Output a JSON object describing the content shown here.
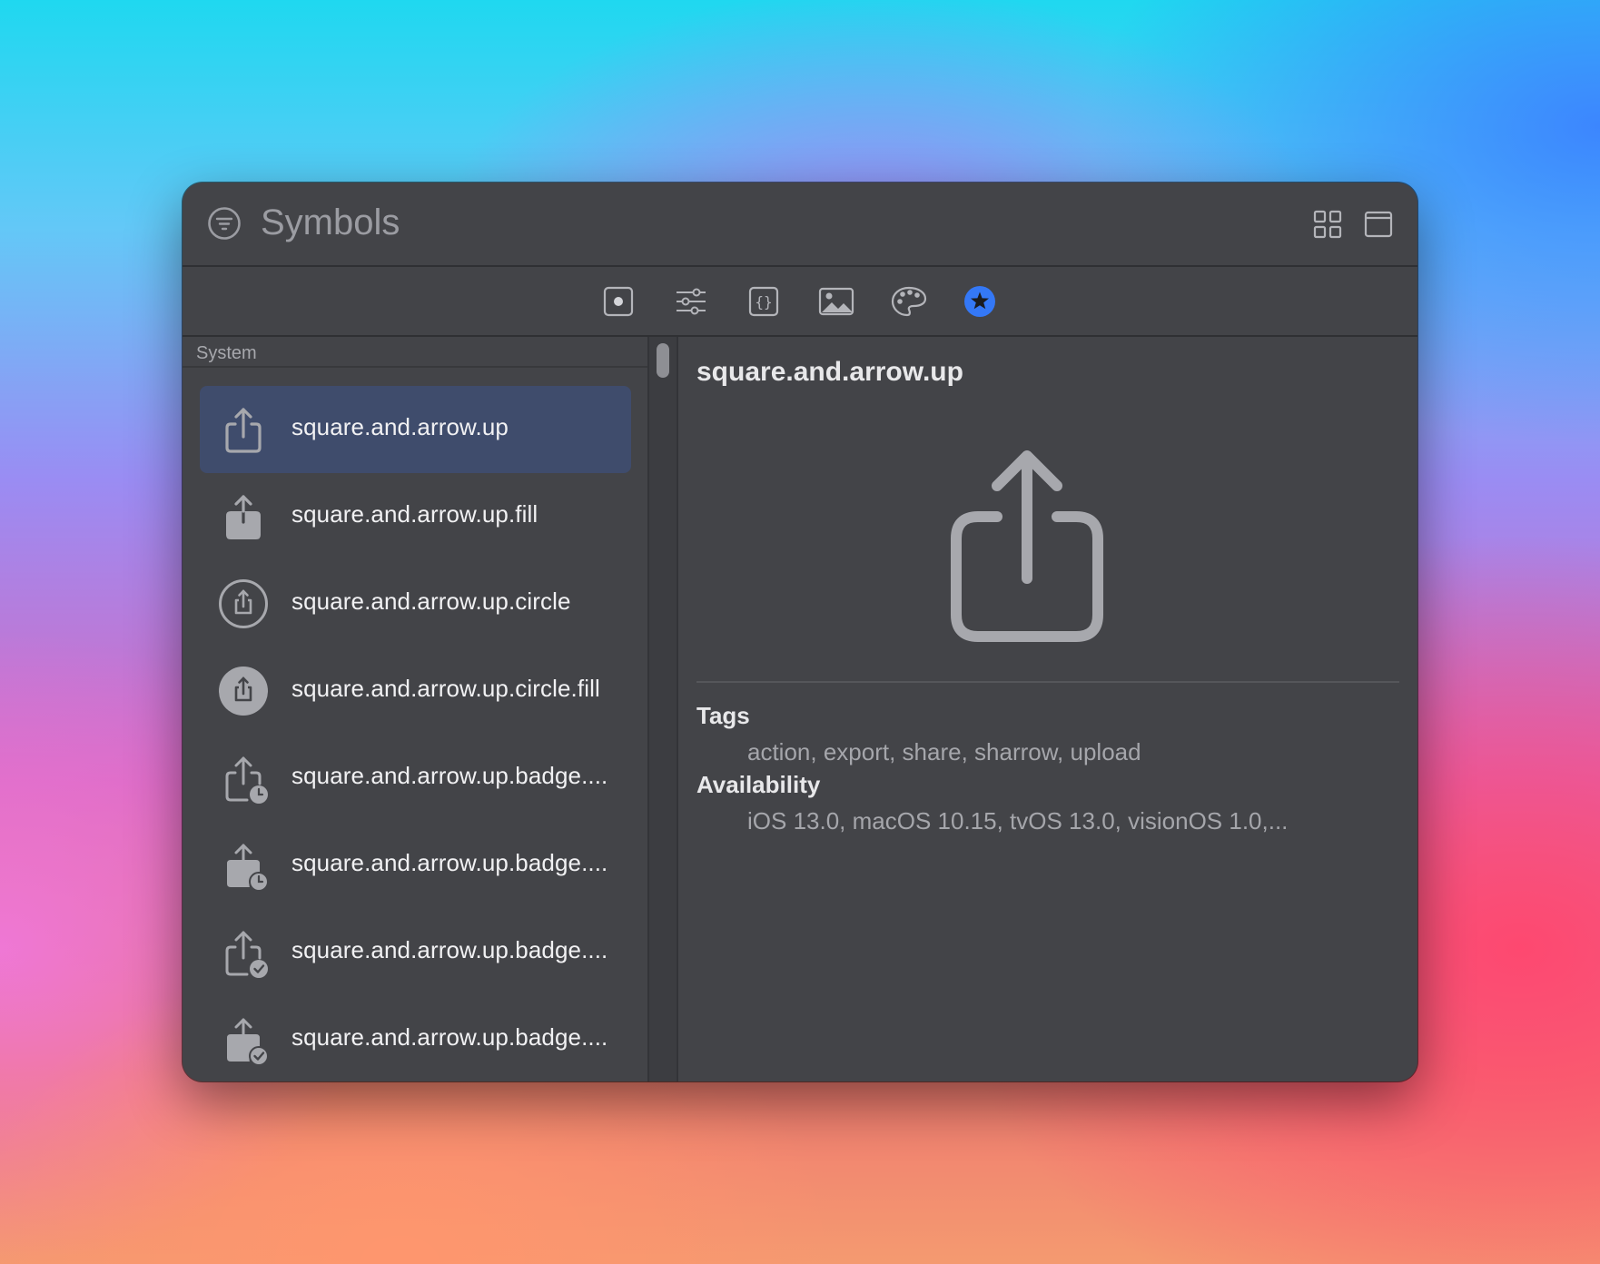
{
  "window": {
    "title": "Symbols"
  },
  "toolbar": {
    "items": [
      {
        "name": "record-icon"
      },
      {
        "name": "sliders-icon"
      },
      {
        "name": "braces-icon"
      },
      {
        "name": "photo-icon"
      },
      {
        "name": "palette-icon"
      },
      {
        "name": "star-circle-icon",
        "active": true
      }
    ]
  },
  "sidebar": {
    "section": "System",
    "items": [
      {
        "label": "square.and.arrow.up",
        "icon": "square-arrow-up-icon",
        "selected": true
      },
      {
        "label": "square.and.arrow.up.fill",
        "icon": "square-arrow-up-fill-icon"
      },
      {
        "label": "square.and.arrow.up.circle",
        "icon": "square-arrow-up-circle-icon"
      },
      {
        "label": "square.and.arrow.up.circle.fill",
        "icon": "square-arrow-up-circle-fill-icon"
      },
      {
        "label": "square.and.arrow.up.badge....",
        "icon": "square-arrow-up-badge-clock-icon"
      },
      {
        "label": "square.and.arrow.up.badge....",
        "icon": "square-arrow-up-fill-badge-clock-icon"
      },
      {
        "label": "square.and.arrow.up.badge....",
        "icon": "square-arrow-up-badge-checkmark-icon"
      },
      {
        "label": "square.and.arrow.up.badge....",
        "icon": "square-arrow-up-fill-badge-checkmark-icon"
      }
    ]
  },
  "detail": {
    "title": "square.and.arrow.up",
    "tags_heading": "Tags",
    "tags": "action, export, share, sharrow, upload",
    "availability_heading": "Availability",
    "availability": "iOS 13.0, macOS 10.15, tvOS 13.0, visionOS 1.0,..."
  },
  "colors": {
    "window_bg": "#434448",
    "selection": "#3f4c6c",
    "accent": "#3478f6",
    "icon_gray": "#a7a8ad"
  }
}
